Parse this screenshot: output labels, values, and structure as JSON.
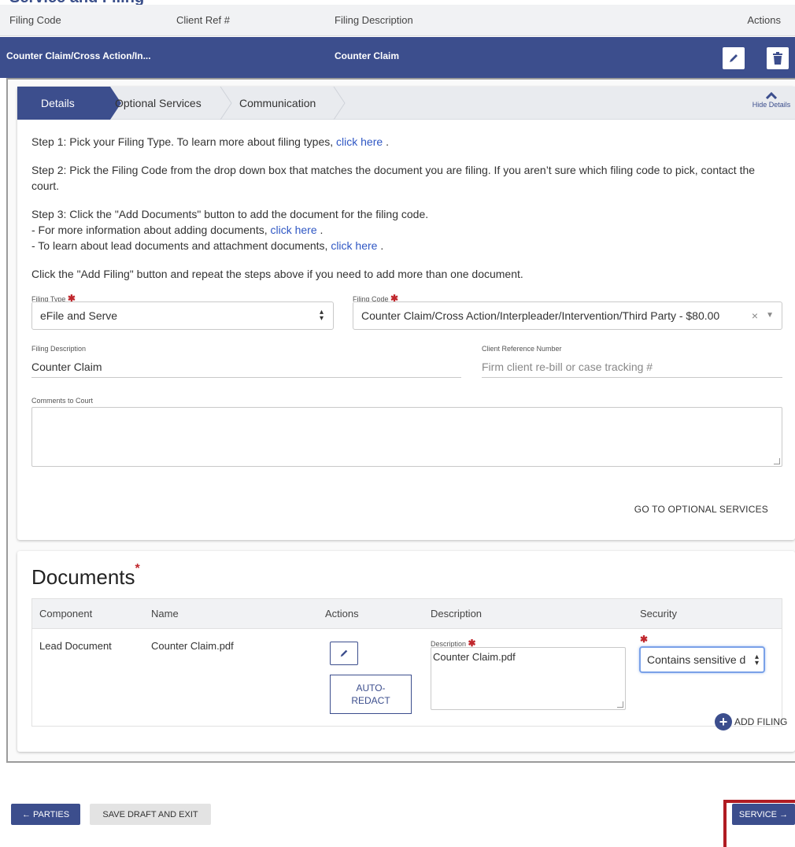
{
  "page_heading": "Service and Filing",
  "filings_table": {
    "headers": {
      "code": "Filing Code",
      "client_ref": "Client Ref #",
      "description": "Filing Description",
      "actions": "Actions"
    },
    "row": {
      "code": "Counter Claim/Cross Action/In...",
      "description": "Counter Claim"
    }
  },
  "tabs": {
    "details": "Details",
    "optional": "Optional Services",
    "communication": "Communication",
    "hide_details": "Hide Details"
  },
  "steps": {
    "step1": "Step 1: Pick your Filing Type. To learn more about filing types,",
    "step1_link": "click here",
    "step2": "Step 2: Pick the Filing Code from the drop down box that matches the document you are filing. If you aren’t sure which filing code to pick, contact the court.",
    "step3": "Step 3: Click the \"Add Documents\" button to add the document for the filing code.",
    "step3a": "- For more information about adding documents,",
    "step3a_link": "click here",
    "step3b": "- To learn about lead documents and attachment documents,",
    "step3b_link": "click here",
    "add_filing_note": "Click the \"Add Filing\" button and repeat the steps above if you need to add more than one document.",
    "period": "."
  },
  "form": {
    "filing_type_label": "Filing Type",
    "filing_type_value": "eFile and Serve",
    "filing_code_label": "Filing Code",
    "filing_code_value": "Counter Claim/Cross Action/Interpleader/Intervention/Third Party - $80.00",
    "filing_description_label": "Filing Description",
    "filing_description_value": "Counter Claim",
    "client_ref_label": "Client Reference Number",
    "client_ref_placeholder": "Firm client re-bill or case tracking #",
    "comments_label": "Comments to Court",
    "required_mark": "✱",
    "clear_x": "×",
    "goto_optional": "GO TO OPTIONAL SERVICES"
  },
  "documents": {
    "title": "Documents",
    "required_mark": "*",
    "headers": {
      "component": "Component",
      "name": "Name",
      "actions": "Actions",
      "description": "Description",
      "security": "Security"
    },
    "row": {
      "component": "Lead Document",
      "name": "Counter Claim.pdf",
      "auto_redact": "AUTO-\nREDACT",
      "description_label": "Description",
      "description_value": "Counter Claim.pdf",
      "security_value": "Contains sensitive data"
    }
  },
  "footer": {
    "add_filing": "ADD FILING",
    "parties": "← PARTIES",
    "save_draft": "SAVE DRAFT AND EXIT",
    "service": "SERVICE →"
  },
  "colors": {
    "primary": "#3c4e8d",
    "required": "#c0272d",
    "highlight": "#b01c22",
    "link": "#2f57c4"
  },
  "icons": [
    "pencil-icon",
    "trash-icon",
    "chevron-up-icon",
    "plus-circle-icon",
    "select-arrows-icon"
  ]
}
